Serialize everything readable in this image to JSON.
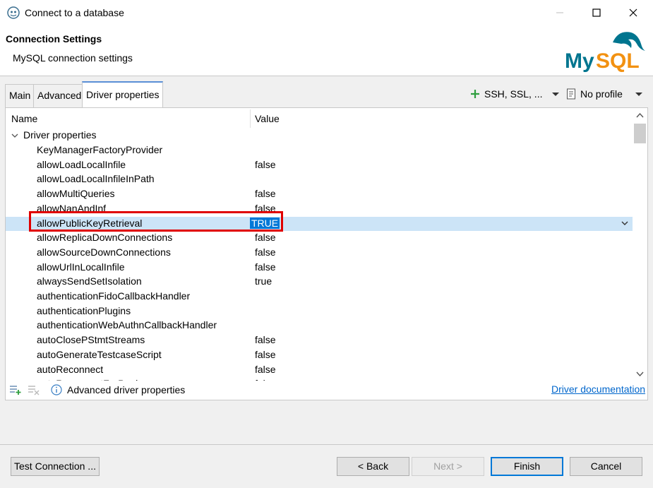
{
  "window": {
    "title": "Connect to a database"
  },
  "header": {
    "title": "Connection Settings",
    "subtitle": "MySQL connection settings",
    "logo_text": "MySQL"
  },
  "tabs": [
    {
      "label": "Main",
      "active": false
    },
    {
      "label": "Advanced",
      "active": false
    },
    {
      "label": "Driver properties",
      "active": true
    }
  ],
  "toolbar": {
    "ssh_label": "SSH, SSL, ...",
    "profile_label": "No profile"
  },
  "table": {
    "columns": {
      "name": "Name",
      "value": "Value"
    },
    "group_label": "Driver properties",
    "rows": [
      {
        "name": "KeyManagerFactoryProvider",
        "value": ""
      },
      {
        "name": "allowLoadLocalInfile",
        "value": "false"
      },
      {
        "name": "allowLoadLocalInfileInPath",
        "value": ""
      },
      {
        "name": "allowMultiQueries",
        "value": "false"
      },
      {
        "name": "allowNanAndInf",
        "value": "false"
      },
      {
        "name": "allowPublicKeyRetrieval",
        "value": "TRUE",
        "selected": true
      },
      {
        "name": "allowReplicaDownConnections",
        "value": "false"
      },
      {
        "name": "allowSourceDownConnections",
        "value": "false"
      },
      {
        "name": "allowUrlInLocalInfile",
        "value": "false"
      },
      {
        "name": "alwaysSendSetIsolation",
        "value": "true"
      },
      {
        "name": "authenticationFidoCallbackHandler",
        "value": ""
      },
      {
        "name": "authenticationPlugins",
        "value": ""
      },
      {
        "name": "authenticationWebAuthnCallbackHandler",
        "value": ""
      },
      {
        "name": "autoClosePStmtStreams",
        "value": "false"
      },
      {
        "name": "autoGenerateTestcaseScript",
        "value": "false"
      },
      {
        "name": "autoReconnect",
        "value": "false"
      },
      {
        "name": "autoReconnectForPools",
        "value": "false"
      }
    ]
  },
  "bottom": {
    "advanced_label": "Advanced driver properties",
    "doc_link": "Driver documentation"
  },
  "buttons": {
    "test": "Test Connection ...",
    "back": "< Back",
    "next": "Next >",
    "finish": "Finish",
    "cancel": "Cancel"
  },
  "colors": {
    "accent": "#0078d7",
    "highlight": "#e00000",
    "selection": "#cce4f7",
    "mysql_blue": "#00758f",
    "mysql_orange": "#f29111"
  }
}
